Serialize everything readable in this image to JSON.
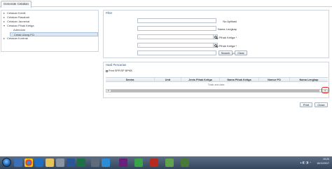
{
  "tab": {
    "label": "Generate Cetakan"
  },
  "tree": {
    "items": [
      {
        "label": "Cetakan Kredit",
        "expanded": false
      },
      {
        "label": "Cetakan Rasabah",
        "expanded": false
      },
      {
        "label": "Cetakan Jaunenal",
        "expanded": false
      },
      {
        "label": "Cetakan Pihak Ketiga",
        "expanded": true
      },
      {
        "label": "Adendum",
        "expanded": null
      },
      {
        "label": "Cetak Ulang PO",
        "expanded": null,
        "selected": true
      },
      {
        "label": "Cetakan Kontrak",
        "expanded": false
      }
    ]
  },
  "filter": {
    "title": "Filter",
    "fields": [
      {
        "label": "No Aplikasi",
        "value": ""
      },
      {
        "label": "Nama Lengkap",
        "value": ""
      },
      {
        "label": "Jenis Pihak Ketiga *",
        "value": "-"
      },
      {
        "label": "Nama Pihak Ketiga *",
        "value": "-"
      },
      {
        "label": "Nomor PO",
        "value": ""
      }
    ],
    "search_label": "Search",
    "clear_label": "Clear"
  },
  "results": {
    "title": "Hasil Pencarian",
    "checkbox_label": "Print SPP/SP BPKB",
    "columns": [
      "Sentra",
      "Unit",
      "Jenis Pihak Ketiga",
      "Nama Pihak Ketiga",
      "Nomor PO",
      "Nama Lengkap"
    ],
    "empty_text": "Tidak ada data"
  },
  "actions": {
    "print_label": "Print",
    "close_label": "Close"
  },
  "taskbar": {
    "icons": [
      "windows-start",
      "ie",
      "chrome",
      "outlook",
      "files",
      "app",
      "word",
      "excel",
      "visual-studio",
      "app2",
      "filezilla",
      "app3",
      "app4",
      "app5"
    ],
    "time": "19:20",
    "date": "16/11/2017"
  },
  "colors": {
    "accent": "#2a5d8f",
    "selection": "#dbe7f4",
    "taskbar": "#33465c",
    "highlight_ring": "#e02020"
  }
}
